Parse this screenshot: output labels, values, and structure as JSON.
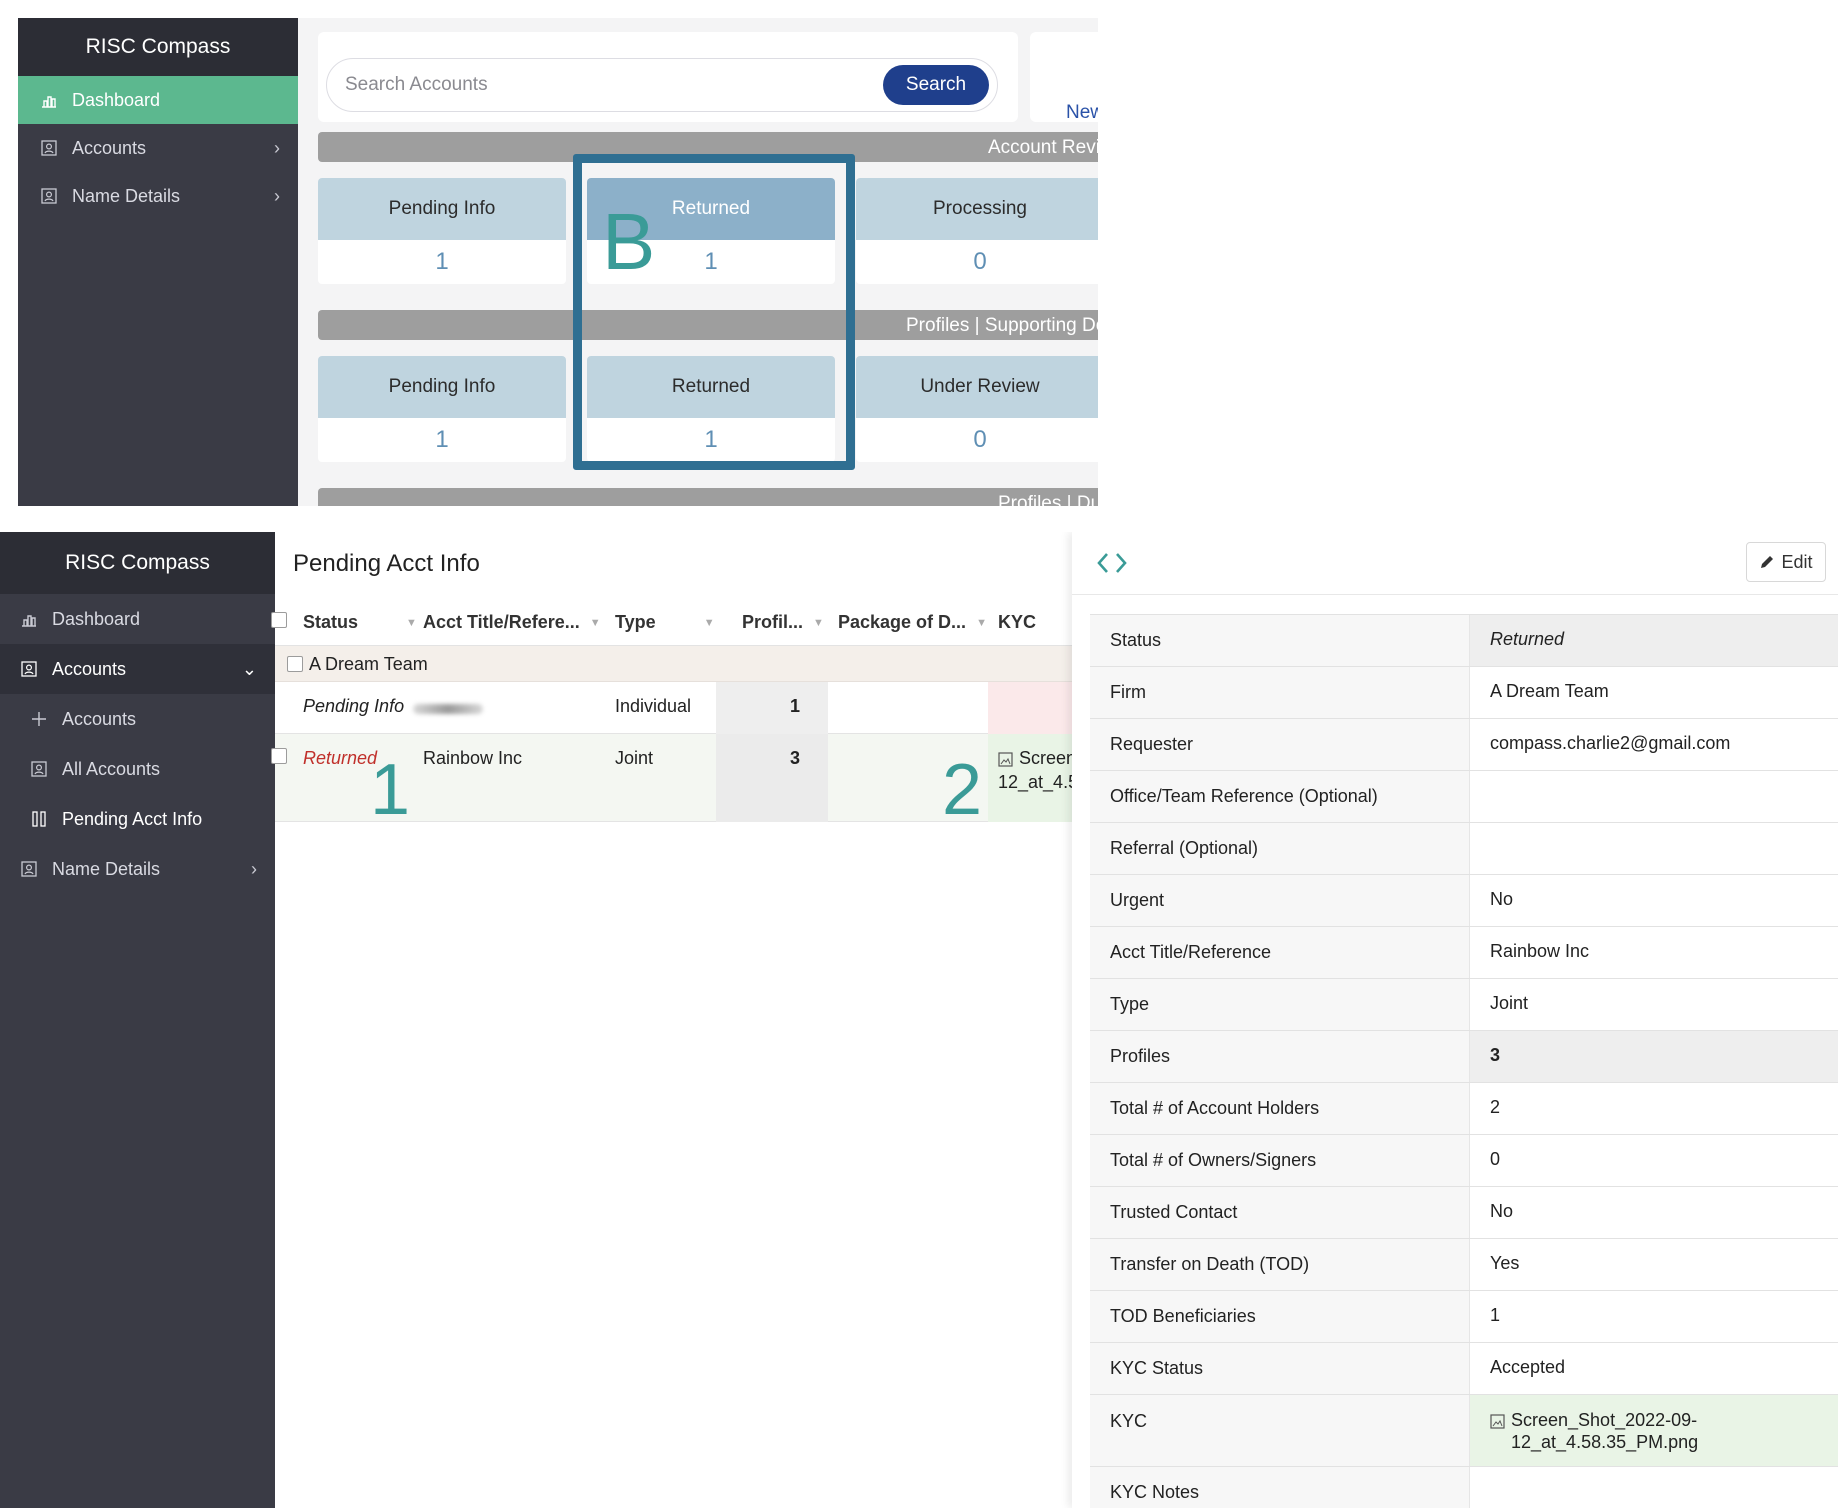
{
  "top": {
    "app_title": "RISC Compass",
    "nav": [
      {
        "label": "Dashboard",
        "icon": "dashboard-icon",
        "active": true
      },
      {
        "label": "Accounts",
        "icon": "accounts-icon",
        "chevron": "›"
      },
      {
        "label": "Name Details",
        "icon": "name-details-icon",
        "chevron": "›"
      }
    ],
    "search": {
      "placeholder": "Search Accounts",
      "button": "Search"
    },
    "new_card_label": "New",
    "section1": "Account Review",
    "section2": "Profiles | Supporting Documents",
    "section3": "Profiles | Du",
    "cards_row1": [
      {
        "label": "Pending Info",
        "value": "1"
      },
      {
        "label": "Returned",
        "value": "1"
      },
      {
        "label": "Processing",
        "value": "0"
      }
    ],
    "cards_row2": [
      {
        "label": "Pending Info",
        "value": "1"
      },
      {
        "label": "Returned",
        "value": "1"
      },
      {
        "label": "Under Review",
        "value": "0"
      }
    ],
    "marker": "B",
    "colors": {
      "highlight": "#2f6f92",
      "marker": "#3a9b97",
      "active_nav": "#5cb88f"
    }
  },
  "bottom": {
    "app_title": "RISC Compass",
    "nav": [
      {
        "label": "Dashboard"
      },
      {
        "label": "Accounts",
        "chevron": "⌄"
      },
      {
        "label": "Accounts"
      },
      {
        "label": "All Accounts"
      },
      {
        "label": "Pending Acct Info",
        "active": true
      },
      {
        "label": "Name Details",
        "chevron": "›"
      }
    ],
    "list": {
      "title": "Pending Acct Info",
      "columns": [
        "Status",
        "Acct Title/Refere...",
        "Type",
        "Profil...",
        "Package of D...",
        "KYC"
      ],
      "group": "A Dream Team",
      "rows": [
        {
          "status": "Pending Info",
          "title": "",
          "type": "Individual",
          "profiles": "1",
          "package": "",
          "kyc": ""
        },
        {
          "status": "Returned",
          "title": "Rainbow Inc",
          "type": "Joint",
          "profiles": "3",
          "package": "",
          "kyc_line1": "Screen",
          "kyc_line2": "12_at_4.5"
        }
      ],
      "markers": [
        "1",
        "2"
      ]
    },
    "detail": {
      "edit_label": "Edit",
      "fields": [
        {
          "label": "Status",
          "value": "Returned"
        },
        {
          "label": "Firm",
          "value": "A Dream Team"
        },
        {
          "label": "Requester",
          "value": "compass.charlie2@gmail.com"
        },
        {
          "label": "Office/Team Reference (Optional)",
          "value": ""
        },
        {
          "label": "Referral (Optional)",
          "value": ""
        },
        {
          "label": "Urgent",
          "value": "No"
        },
        {
          "label": "Acct Title/Reference",
          "value": "Rainbow Inc"
        },
        {
          "label": "Type",
          "value": "Joint"
        },
        {
          "label": "Profiles",
          "value": "3"
        },
        {
          "label": "Total # of Account Holders",
          "value": "2"
        },
        {
          "label": "Total # of Owners/Signers",
          "value": "0"
        },
        {
          "label": "Trusted Contact",
          "value": "No"
        },
        {
          "label": "Transfer on Death (TOD)",
          "value": "Yes"
        },
        {
          "label": "TOD Beneficiaries",
          "value": "1"
        },
        {
          "label": "KYC Status",
          "value": "Accepted"
        },
        {
          "label": "KYC",
          "value_line1": "Screen_Shot_2022-09-",
          "value_line2": "12_at_4.58.35_PM.png"
        },
        {
          "label": "KYC Notes",
          "value": ""
        }
      ]
    }
  }
}
